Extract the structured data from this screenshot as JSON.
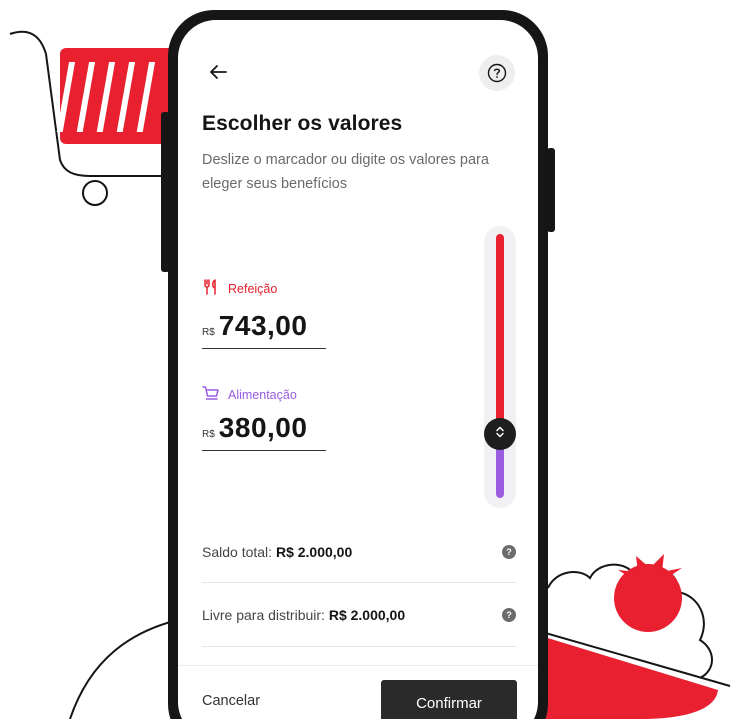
{
  "screen": {
    "title": "Escolher os valores",
    "subtitle": "Deslize o marcador ou digite os valores para eleger seus benefícios"
  },
  "icons": {
    "back": "arrow-left-icon",
    "help": "help-circle-icon",
    "refeicao": "fork-knife-icon",
    "alimentacao": "shopping-cart-icon",
    "thumb": "chevron-up-down-icon",
    "info": "info-icon"
  },
  "benefits": [
    {
      "label": "Refeição",
      "currency": "R$",
      "amount": "743,00",
      "color": "#e8202f"
    },
    {
      "label": "Alimentação",
      "currency": "R$",
      "amount": "380,00",
      "color": "#9a5ce0"
    }
  ],
  "slider": {
    "refeicao_fraction": 0.74,
    "alimentacao_fraction": 0.26
  },
  "summary": {
    "saldo_label": "Saldo total:",
    "saldo_value": "R$ 2.000,00",
    "livre_label": "Livre para distribuir:",
    "livre_value": "R$ 2.000,00"
  },
  "actions": {
    "cancel_label": "Cancelar",
    "confirm_label": "Confirmar"
  },
  "colors": {
    "accent_red": "#e8202f",
    "accent_purple": "#9a5ce0",
    "dark": "#1f1f1f"
  }
}
